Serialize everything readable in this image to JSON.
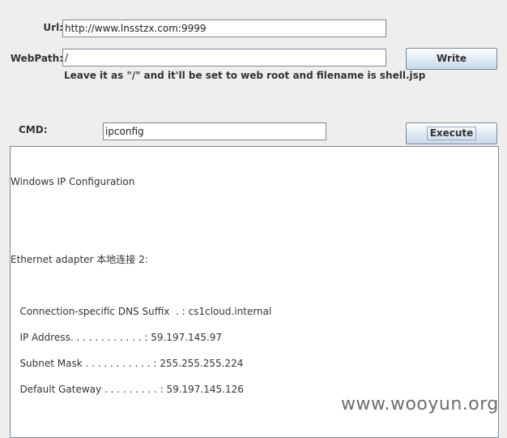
{
  "form": {
    "url_label": "Url:",
    "url_value": "http://www.lnsstzx.com:9999",
    "webpath_label": "WebPath:",
    "webpath_value": "/",
    "hint": "Leave it as \"/\" and it'll be set to web root and filename is shell.jsp",
    "write_button": "Write",
    "cmd_label": "CMD:",
    "cmd_value": "ipconfig",
    "execute_button": "Execute"
  },
  "output": {
    "lines": [
      "Windows IP Configuration",
      "Ethernet adapter 本地连接 2:",
      "   Connection-specific DNS Suffix  . : cs1cloud.internal",
      "   IP Address. . . . . . . . . . . . : 59.197.145.97",
      "   Subnet Mask . . . . . . . . . . . : 255.255.255.224",
      "   Default Gateway . . . . . . . . . : 59.197.145.126"
    ]
  },
  "watermark": "www.wooyun.org"
}
